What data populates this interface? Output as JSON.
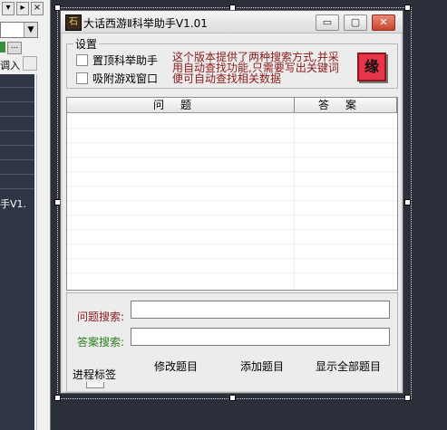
{
  "ide": {
    "panel_label_1": "调入",
    "panel_label_2": "手V1.",
    "close_glyph": "×",
    "dots": "..."
  },
  "window": {
    "title": "大话西游Ⅱ科举助手V1.01",
    "icon_glyph": "石",
    "minimize": "▭",
    "maximize": "▢",
    "close": "✕"
  },
  "settings": {
    "legend": "设置",
    "topmost_label": "置顶科举助手",
    "topmost_checked": false,
    "attach_label": "吸附游戏窗口",
    "attach_checked": false,
    "notice": "这个版本提供了两种搜索方式,并采用自动查找功能,只需要写出关键词便可自动查找相关数据",
    "yuan_label": "缘",
    "yuan_color": "#e6344a",
    "notice_color": "#8b1a1a"
  },
  "table": {
    "columns": [
      "问题",
      "答案"
    ],
    "rows": []
  },
  "search": {
    "question_label": "问题搜索:",
    "question_value": "",
    "question_color": "#8b1a1a",
    "answer_label": "答案搜索:",
    "answer_value": "",
    "answer_color": "#2e7d1e"
  },
  "actions": {
    "edit": "修改题目",
    "add": "添加题目",
    "show_all": "显示全部题目"
  },
  "status": {
    "progress_label": "进程标签"
  }
}
